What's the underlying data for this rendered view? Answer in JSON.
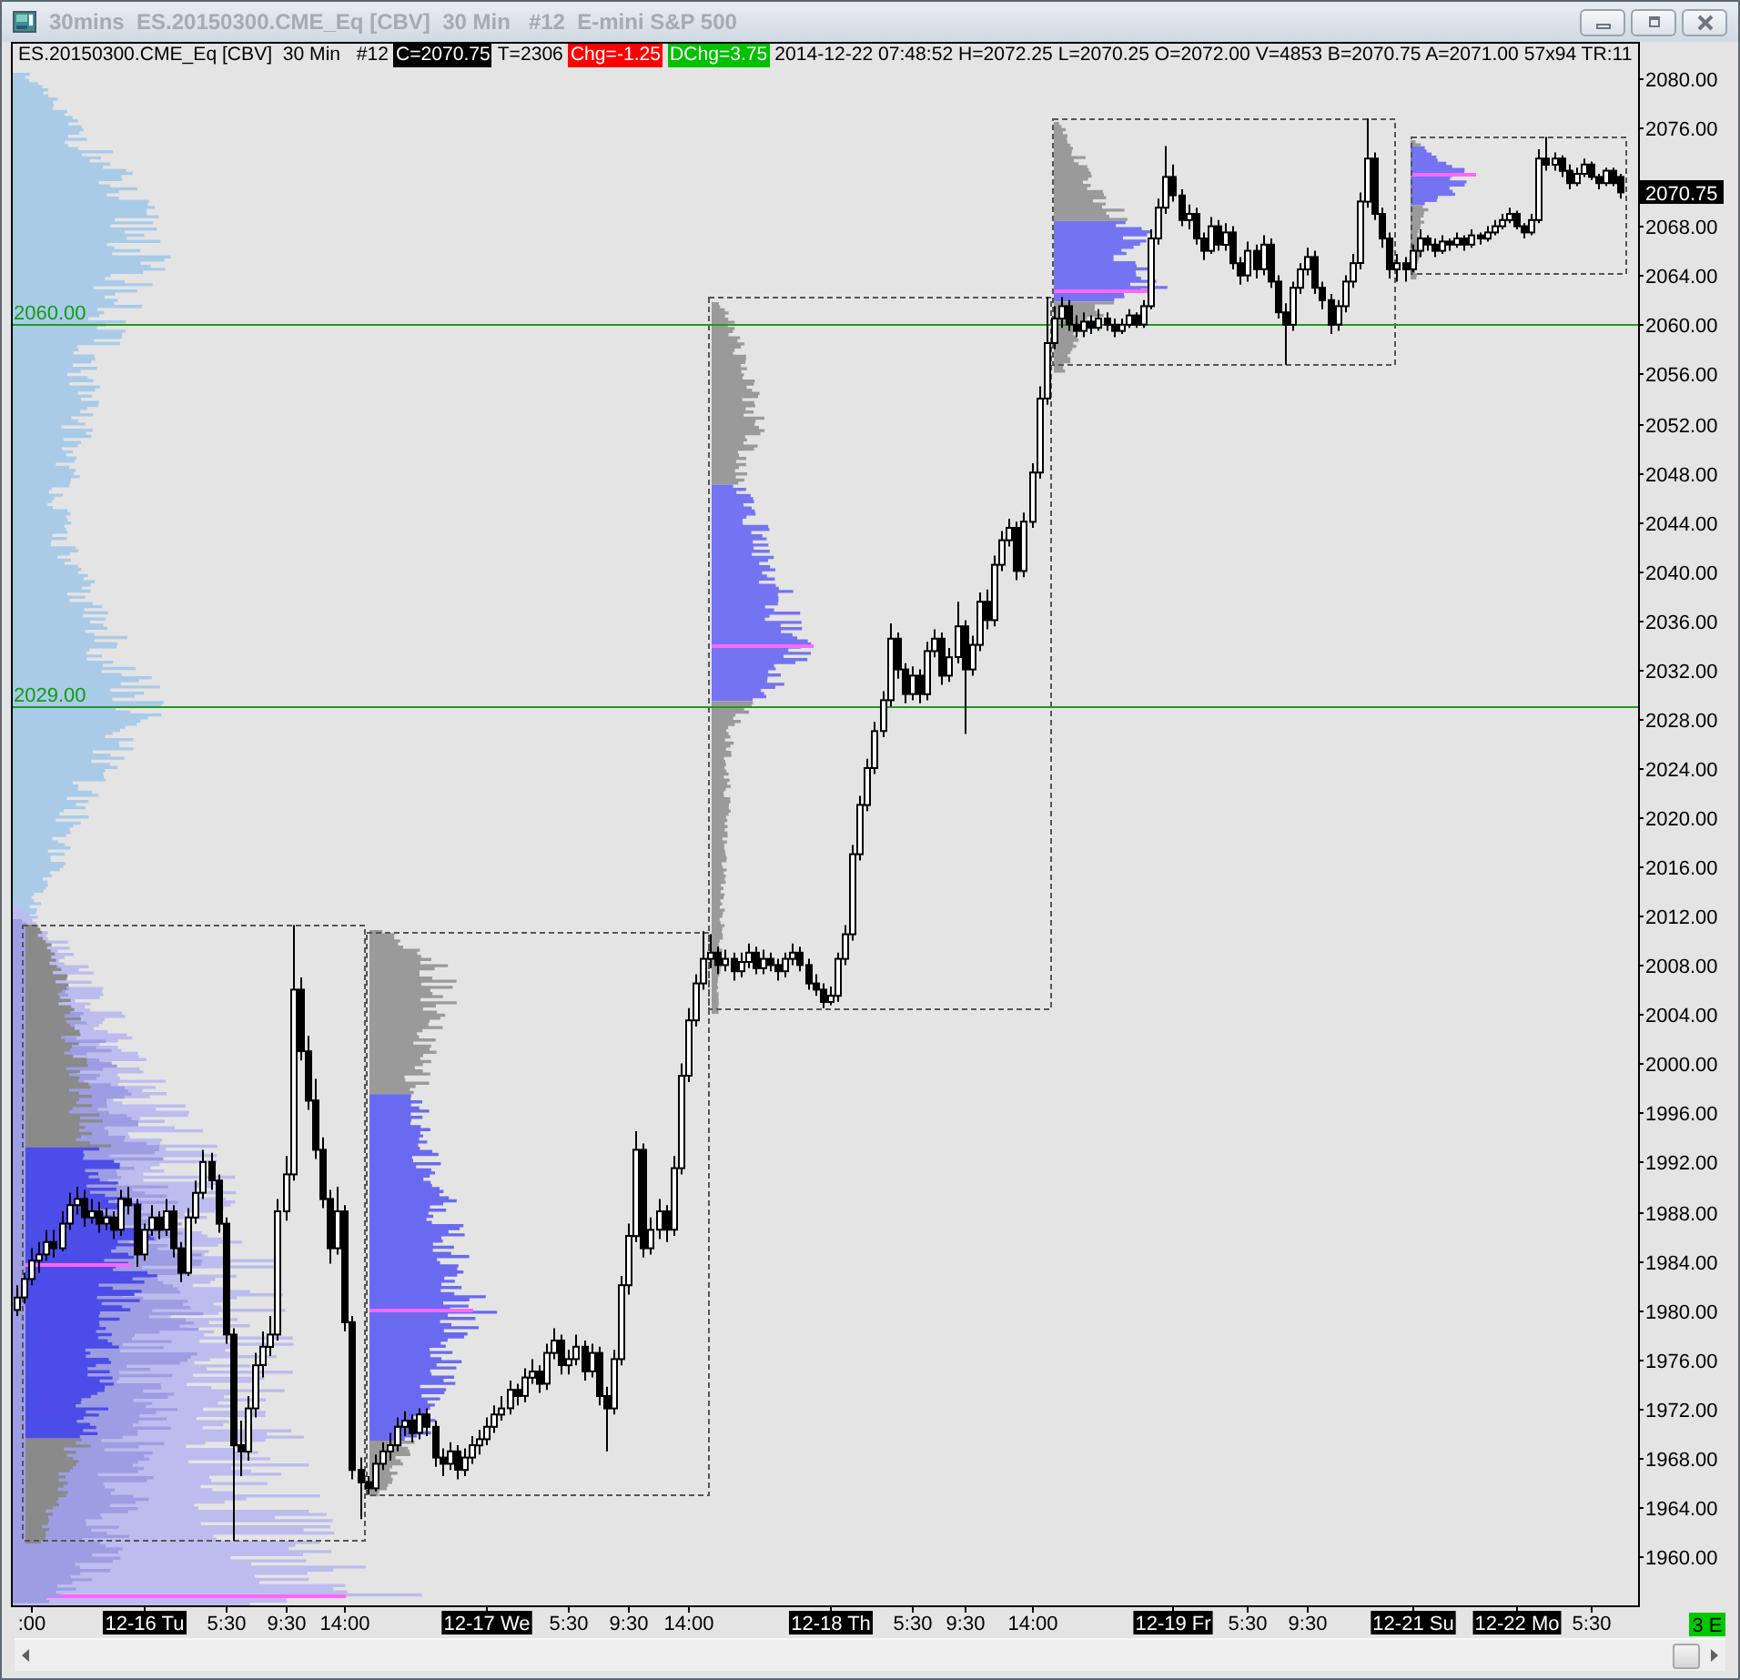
{
  "window": {
    "title": "30mins  ES.20150300.CME_Eq [CBV]  30 Min   #12  E-mini S&P 500"
  },
  "header": [
    {
      "kind": "plain",
      "text": "ES.20150300.CME_Eq [CBV]  30 Min   #12"
    },
    {
      "kind": "badge",
      "text": "C=2070.75",
      "color": "#000000"
    },
    {
      "kind": "plain",
      "text": "T=2306"
    },
    {
      "kind": "badge",
      "text": "Chg=-1.25",
      "color": "#ff0000"
    },
    {
      "kind": "badge",
      "text": "DChg=3.75",
      "color": "#00c000"
    },
    {
      "kind": "plain",
      "text": "2014-12-22 07:48:52 H=2072.25 L=2070.25 O=2072.00 V=4853 B=2070.75 A=2071.00 57x94 TR:11"
    }
  ],
  "chart": {
    "chart_data": {
      "type": "candlestick",
      "categories": [
        null,
        null,
        ":00",
        null,
        null,
        null,
        null,
        null,
        null,
        null,
        null,
        null,
        null,
        null,
        null,
        null,
        null,
        "12-16 Tu",
        null,
        null,
        null,
        null,
        null,
        null,
        null,
        null,
        null,
        null,
        "5:30",
        null,
        null,
        null,
        null,
        null,
        null,
        null,
        "9:30",
        null,
        null,
        null,
        null,
        null,
        null,
        null,
        "14:00",
        null,
        null,
        null,
        null,
        null,
        null,
        null,
        null,
        null,
        null,
        null,
        null,
        null,
        null,
        null,
        null,
        null,
        null,
        "12-17 We",
        null,
        null,
        null,
        null,
        null,
        null,
        null,
        null,
        null,
        null,
        "5:30",
        null,
        null,
        null,
        null,
        null,
        null,
        null,
        "9:30",
        null,
        null,
        null,
        null,
        null,
        null,
        null,
        "14:00",
        null,
        null,
        null,
        null,
        null,
        null,
        null,
        null,
        null,
        null,
        null,
        null,
        null,
        null,
        null,
        null,
        null,
        null,
        "12-18 Th",
        null,
        null,
        null,
        null,
        null,
        null,
        null,
        null,
        null,
        null,
        "5:30",
        null,
        null,
        null,
        null,
        null,
        null,
        "9:30",
        null,
        null,
        null,
        null,
        null,
        null,
        null,
        null,
        "14:00",
        null,
        null,
        null,
        null,
        null,
        null,
        null,
        null,
        null,
        null,
        null,
        null,
        null,
        null,
        null,
        null,
        null,
        null,
        "12-19 Fr",
        null,
        null,
        null,
        null,
        null,
        null,
        null,
        null,
        null,
        "5:30",
        null,
        null,
        null,
        null,
        null,
        null,
        null,
        "9:30",
        null,
        null,
        null,
        null,
        null,
        null,
        null,
        null,
        null,
        null,
        null,
        null,
        null,
        "12-21 Su",
        null,
        null,
        null,
        null,
        null,
        null,
        null,
        null,
        null,
        null,
        null,
        null,
        null,
        "12-22 Mo",
        null,
        null,
        null,
        null,
        null,
        null,
        null,
        null,
        null,
        "5:30",
        null,
        null,
        null,
        null
      ],
      "ohlc": [
        [
          1980,
          1982,
          1979.5,
          1981
        ],
        [
          1981,
          1983,
          1980.5,
          1982.5
        ],
        [
          1982.5,
          1985,
          1982,
          1984
        ],
        [
          1984,
          1985.5,
          1983,
          1984.5
        ],
        [
          1984.5,
          1986.5,
          1984,
          1985.5
        ],
        [
          1985.5,
          1986.5,
          1984.25,
          1985
        ],
        [
          1985,
          1988,
          1984.75,
          1987
        ],
        [
          1987,
          1989.5,
          1986.5,
          1988.5
        ],
        [
          1988.5,
          1990,
          1987.75,
          1989
        ],
        [
          1989,
          1989.75,
          1986.75,
          1987.5
        ],
        [
          1987.5,
          1989,
          1987,
          1988
        ],
        [
          1988,
          1988.75,
          1986.25,
          1987
        ],
        [
          1987,
          1988.25,
          1986.5,
          1987.5
        ],
        [
          1987.5,
          1988,
          1985.75,
          1986.5
        ],
        [
          1986.5,
          1989.75,
          1986,
          1989
        ],
        [
          1989,
          1990,
          1987.75,
          1988.5
        ],
        [
          1988.5,
          1989,
          1983.5,
          1984.5
        ],
        [
          1984.5,
          1987,
          1984,
          1986.5
        ],
        [
          1986.5,
          1988.5,
          1986,
          1987.5
        ],
        [
          1987.5,
          1988,
          1985.75,
          1986.5
        ],
        [
          1986.5,
          1989,
          1986,
          1988
        ],
        [
          1988,
          1988.5,
          1984.25,
          1985
        ],
        [
          1985,
          1985.5,
          1982.25,
          1983
        ],
        [
          1983,
          1988.25,
          1982.75,
          1987.5
        ],
        [
          1987.5,
          1990.5,
          1987,
          1989.5
        ],
        [
          1989.5,
          1993,
          1989,
          1992
        ],
        [
          1992,
          1992.75,
          1989.75,
          1990.5
        ],
        [
          1990.5,
          1991,
          1986.25,
          1987
        ],
        [
          1987,
          1987.5,
          1977.25,
          1978
        ],
        [
          1978,
          1978.5,
          1961.25,
          1969
        ],
        [
          1969,
          1971,
          1966.5,
          1968.5
        ],
        [
          1968.5,
          1973,
          1967.75,
          1972
        ],
        [
          1972,
          1976.5,
          1971.25,
          1975.5
        ],
        [
          1975.5,
          1978.25,
          1974.5,
          1977
        ],
        [
          1977,
          1979.5,
          1976.25,
          1978
        ],
        [
          1978,
          1989,
          1977.5,
          1988
        ],
        [
          1988,
          1992.5,
          1987.25,
          1991
        ],
        [
          1991,
          2011.25,
          1990.5,
          2006
        ],
        [
          2006,
          2007,
          2000.25,
          2001
        ],
        [
          2001,
          2002.25,
          1996.25,
          1997
        ],
        [
          1997,
          1998.75,
          1992.25,
          1993
        ],
        [
          1993,
          1994,
          1988.25,
          1989
        ],
        [
          1989,
          1989.75,
          1983.75,
          1985
        ],
        [
          1985,
          1990,
          1984.5,
          1988
        ],
        [
          1988,
          1988.5,
          1978.25,
          1979
        ],
        [
          1979,
          1979.5,
          1966.25,
          1967
        ],
        [
          1967,
          1968,
          1963,
          1966
        ],
        [
          1966,
          1966.5,
          1965,
          1965.5
        ],
        [
          1965.5,
          1968.25,
          1965.25,
          1967.5
        ],
        [
          1967.5,
          1969.25,
          1967,
          1968.5
        ],
        [
          1968.5,
          1970,
          1967.75,
          1969
        ],
        [
          1969,
          1971.25,
          1968.5,
          1970.5
        ],
        [
          1970.5,
          1971.75,
          1969.75,
          1971
        ],
        [
          1971,
          1971.5,
          1969.25,
          1970
        ],
        [
          1970,
          1972,
          1969.5,
          1971.5
        ],
        [
          1971.5,
          1972,
          1969.75,
          1970.5
        ],
        [
          1970.5,
          1971,
          1967.25,
          1968
        ],
        [
          1968,
          1968.75,
          1966.5,
          1967.5
        ],
        [
          1967.5,
          1969.25,
          1967,
          1968.5
        ],
        [
          1968.5,
          1969,
          1966.25,
          1967
        ],
        [
          1967,
          1968.75,
          1966.5,
          1968
        ],
        [
          1968,
          1969.75,
          1967.5,
          1969
        ],
        [
          1969,
          1970.25,
          1968.25,
          1969.5
        ],
        [
          1969.5,
          1971.25,
          1969,
          1970.5
        ],
        [
          1970.5,
          1972.25,
          1970,
          1971.5
        ],
        [
          1971.5,
          1973,
          1971,
          1972
        ],
        [
          1972,
          1974.25,
          1971.5,
          1973.5
        ],
        [
          1973.5,
          1974,
          1972.25,
          1973
        ],
        [
          1973,
          1975.25,
          1972.5,
          1974.5
        ],
        [
          1974.5,
          1976,
          1974,
          1975
        ],
        [
          1975,
          1975.5,
          1973.25,
          1974
        ],
        [
          1974,
          1977.25,
          1973.5,
          1976.5
        ],
        [
          1976.5,
          1978.5,
          1976,
          1977.5
        ],
        [
          1977.5,
          1978,
          1974.75,
          1975.5
        ],
        [
          1975.5,
          1976.75,
          1974.75,
          1976
        ],
        [
          1976,
          1978,
          1975.5,
          1977
        ],
        [
          1977,
          1977.5,
          1974.25,
          1975
        ],
        [
          1975,
          1977.25,
          1974.5,
          1976.5
        ],
        [
          1976.5,
          1977,
          1972.25,
          1973
        ],
        [
          1973,
          1973.75,
          1968.5,
          1972
        ],
        [
          1972,
          1976.75,
          1971.5,
          1976
        ],
        [
          1976,
          1982.75,
          1975.5,
          1982
        ],
        [
          1982,
          1987,
          1981.25,
          1986
        ],
        [
          1986,
          1994.5,
          1985.5,
          1993
        ],
        [
          1993,
          1993.5,
          1984.25,
          1985
        ],
        [
          1985,
          1987.5,
          1984.5,
          1986.5
        ],
        [
          1986.5,
          1989,
          1985.75,
          1988
        ],
        [
          1988,
          1988.5,
          1985.5,
          1986.5
        ],
        [
          1986.5,
          1992.5,
          1986,
          1991.5
        ],
        [
          1991.5,
          2000,
          1991,
          1999
        ],
        [
          1999,
          2004.5,
          1998.5,
          2003.5
        ],
        [
          2003.5,
          2007.25,
          2003,
          2006.5
        ],
        [
          2006.5,
          2010.75,
          2006,
          2008.5
        ],
        [
          2008.5,
          2010.5,
          2007.75,
          2009
        ],
        [
          2009,
          2009.5,
          2007.25,
          2008
        ],
        [
          2008,
          2009.25,
          2007.5,
          2008.5
        ],
        [
          2008.5,
          2009,
          2006.75,
          2007.5
        ],
        [
          2007.5,
          2009,
          2007,
          2008.25
        ],
        [
          2008.25,
          2009.75,
          2007.75,
          2009
        ],
        [
          2009,
          2009.5,
          2007.25,
          2007.75
        ],
        [
          2007.75,
          2009.25,
          2007.25,
          2008.5
        ],
        [
          2008.5,
          2009,
          2007.5,
          2008
        ],
        [
          2008,
          2008.5,
          2006.75,
          2007.5
        ],
        [
          2007.5,
          2009,
          2007,
          2008.5
        ],
        [
          2008.5,
          2009.75,
          2008,
          2009
        ],
        [
          2009,
          2009.5,
          2007.5,
          2008
        ],
        [
          2008,
          2008.5,
          2006,
          2006.5
        ],
        [
          2006.5,
          2007.25,
          2005.5,
          2006
        ],
        [
          2006,
          2006.5,
          2004.5,
          2005
        ],
        [
          2005,
          2006.25,
          2004.75,
          2005.5
        ],
        [
          2005.5,
          2009,
          2005,
          2008.5
        ],
        [
          2008.5,
          2011.25,
          2008,
          2010.5
        ],
        [
          2010.5,
          2017.75,
          2010,
          2017
        ],
        [
          2017,
          2021.75,
          2016.5,
          2021
        ],
        [
          2021,
          2024.75,
          2020.5,
          2024
        ],
        [
          2024,
          2027.75,
          2023.5,
          2027
        ],
        [
          2027,
          2030.25,
          2026.5,
          2029.5
        ],
        [
          2029.5,
          2035.75,
          2029,
          2034.5
        ],
        [
          2034.5,
          2035,
          2031.25,
          2032
        ],
        [
          2032,
          2032.5,
          2029.25,
          2030
        ],
        [
          2030,
          2032.25,
          2029.5,
          2031.5
        ],
        [
          2031.5,
          2032,
          2029.25,
          2030
        ],
        [
          2030,
          2034.25,
          2029.5,
          2033.5
        ],
        [
          2033.5,
          2035.25,
          2033,
          2034.5
        ],
        [
          2034.5,
          2035,
          2030.75,
          2031.5
        ],
        [
          2031.5,
          2033.75,
          2031,
          2033
        ],
        [
          2033,
          2037.5,
          2032.5,
          2035.5
        ],
        [
          2035.5,
          2036,
          2026.75,
          2032
        ],
        [
          2032,
          2034.75,
          2031.5,
          2034
        ],
        [
          2034,
          2038.25,
          2033.5,
          2037.5
        ],
        [
          2037.5,
          2038.5,
          2035.25,
          2036
        ],
        [
          2036,
          2041.25,
          2035.5,
          2040.5
        ],
        [
          2040.5,
          2043.25,
          2040,
          2042.5
        ],
        [
          2042.5,
          2044.25,
          2042,
          2043.5
        ],
        [
          2043.5,
          2044,
          2039.25,
          2040
        ],
        [
          2040,
          2044.75,
          2039.5,
          2044
        ],
        [
          2044,
          2048.75,
          2043.5,
          2048
        ],
        [
          2048,
          2055,
          2047.5,
          2054
        ],
        [
          2054,
          2062.25,
          2053.5,
          2058.5
        ],
        [
          2058.5,
          2061.5,
          2058,
          2060.5
        ],
        [
          2060.5,
          2062.25,
          2059.75,
          2061.5
        ],
        [
          2061.5,
          2062,
          2059.5,
          2060
        ],
        [
          2060,
          2060.75,
          2059,
          2059.5
        ],
        [
          2059.5,
          2061,
          2059,
          2060.25
        ],
        [
          2060.25,
          2060.75,
          2059.25,
          2059.75
        ],
        [
          2059.75,
          2061.25,
          2059.5,
          2060.5
        ],
        [
          2060.5,
          2061,
          2059.5,
          2060
        ],
        [
          2060,
          2060.5,
          2059,
          2059.5
        ],
        [
          2059.5,
          2060.5,
          2059.25,
          2060
        ],
        [
          2060,
          2061.25,
          2059.75,
          2060.75
        ],
        [
          2060.75,
          2061,
          2059.75,
          2060
        ],
        [
          2060,
          2062,
          2059.75,
          2061.5
        ],
        [
          2061.5,
          2067.75,
          2061.25,
          2067
        ],
        [
          2067,
          2070.25,
          2066.5,
          2069.5
        ],
        [
          2069.5,
          2074.5,
          2069,
          2072
        ],
        [
          2072,
          2073,
          2070,
          2070.5
        ],
        [
          2070.5,
          2071,
          2068,
          2068.5
        ],
        [
          2068.5,
          2069.75,
          2067.75,
          2069
        ],
        [
          2069,
          2069.5,
          2066.5,
          2067
        ],
        [
          2067,
          2067.5,
          2065.25,
          2066
        ],
        [
          2066,
          2068.75,
          2065.75,
          2068
        ],
        [
          2068,
          2068.5,
          2066,
          2066.5
        ],
        [
          2066.5,
          2068.25,
          2066,
          2067.5
        ],
        [
          2067.5,
          2068,
          2064.5,
          2065
        ],
        [
          2065,
          2065.5,
          2063.25,
          2064
        ],
        [
          2064,
          2066.75,
          2063.5,
          2066
        ],
        [
          2066,
          2066.5,
          2063.75,
          2064.5
        ],
        [
          2064.5,
          2067.25,
          2064,
          2066.5
        ],
        [
          2066.5,
          2067,
          2063,
          2063.5
        ],
        [
          2063.5,
          2064,
          2060.5,
          2061
        ],
        [
          2061,
          2061.75,
          2056.75,
          2060
        ],
        [
          2060,
          2063.5,
          2059.5,
          2063
        ],
        [
          2063,
          2065,
          2062.5,
          2064.5
        ],
        [
          2064.5,
          2066.25,
          2064,
          2065.5
        ],
        [
          2065.5,
          2066,
          2062.5,
          2063
        ],
        [
          2063,
          2063.5,
          2061.25,
          2062
        ],
        [
          2062,
          2062.5,
          2059.25,
          2060
        ],
        [
          2060,
          2062,
          2059.5,
          2061.5
        ],
        [
          2061.5,
          2064,
          2061,
          2063.5
        ],
        [
          2063.5,
          2065.75,
          2063,
          2065
        ],
        [
          2065,
          2070.75,
          2064.5,
          2070
        ],
        [
          2070,
          2076.75,
          2069.5,
          2073.5
        ],
        [
          2073.5,
          2074,
          2068.5,
          2069
        ],
        [
          2069,
          2069.5,
          2066.25,
          2067
        ],
        [
          2067,
          2067.5,
          2063.75,
          2064.5
        ],
        [
          2064.5,
          2065.75,
          2063.5,
          2065
        ],
        [
          2065,
          2065.5,
          2063.5,
          2064.5
        ],
        [
          2064.5,
          2066.5,
          2064.25,
          2066
        ],
        [
          2066,
          2067.75,
          2065.5,
          2067
        ],
        [
          2067,
          2067.25,
          2066,
          2066.5
        ],
        [
          2066.5,
          2067,
          2065.5,
          2066
        ],
        [
          2066,
          2067.25,
          2065.75,
          2066.75
        ],
        [
          2066.75,
          2067,
          2066,
          2066.5
        ],
        [
          2066.5,
          2067.5,
          2066.25,
          2067
        ],
        [
          2067,
          2067.25,
          2066,
          2066.5
        ],
        [
          2066.5,
          2067.75,
          2066.25,
          2067.25
        ],
        [
          2067.25,
          2067.5,
          2066.5,
          2067
        ],
        [
          2067,
          2068,
          2066.75,
          2067.5
        ],
        [
          2067.5,
          2068.5,
          2067.25,
          2068
        ],
        [
          2068,
          2069,
          2067.75,
          2068.5
        ],
        [
          2068.5,
          2069.5,
          2068.25,
          2069
        ],
        [
          2069,
          2069.25,
          2067.75,
          2068
        ],
        [
          2068,
          2068.25,
          2067,
          2067.5
        ],
        [
          2067.5,
          2069,
          2067.25,
          2068.5
        ],
        [
          2068.5,
          2074.25,
          2068.25,
          2073.5
        ],
        [
          2073.5,
          2075.25,
          2072.5,
          2073
        ],
        [
          2073,
          2074,
          2072.5,
          2073.5
        ],
        [
          2073.5,
          2073.75,
          2072,
          2072.5
        ],
        [
          2072.5,
          2073,
          2071,
          2071.5
        ],
        [
          2071.5,
          2072.75,
          2071.25,
          2072.25
        ],
        [
          2072.25,
          2073.5,
          2072,
          2073
        ],
        [
          2073,
          2073.25,
          2071.75,
          2072
        ],
        [
          2072,
          2072.25,
          2071,
          2071.5
        ],
        [
          2071.5,
          2072.75,
          2071.25,
          2072.5
        ],
        [
          2072.5,
          2072.75,
          2071.25,
          2071.5
        ],
        [
          2072,
          2072.25,
          2070.25,
          2070.75
        ]
      ],
      "ylim": [
        1956,
        2080.9
      ],
      "yticks": [
        {
          "value": 2080,
          "label": "2080.00"
        },
        {
          "value": 2076,
          "label": "2076.00"
        },
        {
          "value": 2068,
          "label": "2068.00"
        },
        {
          "value": 2064,
          "label": "2064.00"
        },
        {
          "value": 2060,
          "label": "2060.00"
        },
        {
          "value": 2056,
          "label": "2056.00"
        },
        {
          "value": 2052,
          "label": "2052.00"
        },
        {
          "value": 2048,
          "label": "2048.00"
        },
        {
          "value": 2044,
          "label": "2044.00"
        },
        {
          "value": 2040,
          "label": "2040.00"
        },
        {
          "value": 2036,
          "label": "2036.00"
        },
        {
          "value": 2032,
          "label": "2032.00"
        },
        {
          "value": 2028,
          "label": "2028.00"
        },
        {
          "value": 2024,
          "label": "2024.00"
        },
        {
          "value": 2020,
          "label": "2020.00"
        },
        {
          "value": 2016,
          "label": "2016.00"
        },
        {
          "value": 2012,
          "label": "2012.00"
        },
        {
          "value": 2008,
          "label": "2008.00"
        },
        {
          "value": 2004,
          "label": "2004.00"
        },
        {
          "value": 2000,
          "label": "2000.00"
        },
        {
          "value": 1996,
          "label": "1996.00"
        },
        {
          "value": 1992,
          "label": "1992.00"
        },
        {
          "value": 1988,
          "label": "1988.00"
        },
        {
          "value": 1984,
          "label": "1984.00"
        },
        {
          "value": 1980,
          "label": "1980.00"
        },
        {
          "value": 1976,
          "label": "1976.00"
        },
        {
          "value": 1972,
          "label": "1972.00"
        },
        {
          "value": 1968,
          "label": "1968.00"
        },
        {
          "value": 1964,
          "label": "1964.00"
        },
        {
          "value": 1960,
          "label": "1960.00"
        }
      ],
      "ref_lines": [
        {
          "axis": "y",
          "value": 2060,
          "label": "2060.00"
        },
        {
          "axis": "y",
          "value": 2029,
          "label": "2029.00"
        }
      ],
      "annotations": [
        "2070.75"
      ]
    },
    "x_labels": [
      {
        "highlighted": false
      },
      {
        "highlighted": true
      },
      {
        "highlighted": false
      },
      {
        "highlighted": false
      },
      {
        "highlighted": false
      },
      {
        "highlighted": true
      },
      {
        "highlighted": false
      },
      {
        "highlighted": false
      },
      {
        "highlighted": false
      },
      {
        "highlighted": true
      },
      {
        "highlighted": false
      },
      {
        "highlighted": false
      },
      {
        "highlighted": false
      },
      {
        "highlighted": true
      },
      {
        "highlighted": false
      },
      {
        "highlighted": false
      },
      {
        "highlighted": true
      },
      {
        "highlighted": true
      },
      {
        "highlighted": false
      }
    ],
    "status_badge": "3 E"
  }
}
